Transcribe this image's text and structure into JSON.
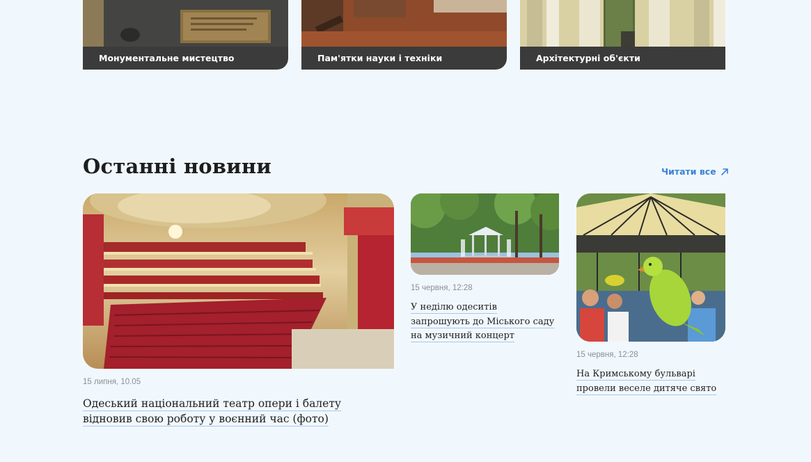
{
  "categories": [
    {
      "label": "Монументальне мистецтво"
    },
    {
      "label": "Пам'ятки науки і техніки"
    },
    {
      "label": "Архітектурні об'єкти"
    }
  ],
  "news_section": {
    "title": "Останні новини",
    "read_all_label": "Читати все",
    "read_all_icon": "arrow-up-right-icon",
    "accent_color": "#3b82d6",
    "items": [
      {
        "date": "15 липня, 10.05",
        "headline": "Одеський національний театр опери і балету відновив свою роботу у воєнний час (фото)"
      },
      {
        "date": "15 червня, 12:28",
        "headline": "У неділю одеситів запрошують до Міського саду на музичний концерт"
      },
      {
        "date": "15 червня, 12:28",
        "headline": "На Кримському бульварі провели веселе дитяче свято"
      }
    ]
  }
}
